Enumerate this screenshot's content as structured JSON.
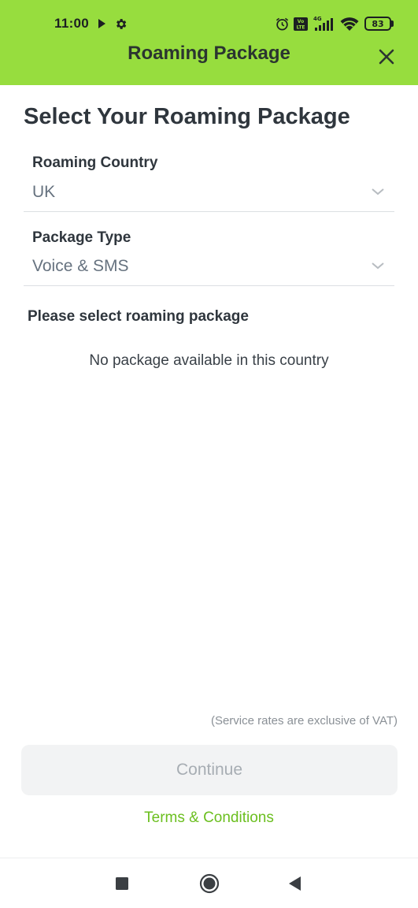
{
  "status_bar": {
    "time": "11:00",
    "battery": "83",
    "network": "4G",
    "icons": [
      "play-icon",
      "gear-icon",
      "alarm-icon",
      "volte-icon",
      "signal-icon",
      "wifi-icon",
      "battery-icon"
    ]
  },
  "app_bar": {
    "title": "Roaming Package",
    "close_icon": "close-icon"
  },
  "main": {
    "title": "Select Your Roaming Package",
    "country_field": {
      "label": "Roaming Country",
      "value": "UK"
    },
    "package_type_field": {
      "label": "Package Type",
      "value": "Voice & SMS"
    },
    "package_section_label": "Please select roaming package",
    "empty_message": "No package available in this country",
    "vat_note": "(Service rates are exclusive of VAT)",
    "continue_label": "Continue",
    "terms_label": "Terms & Conditions"
  },
  "nav_bar": {
    "icons": [
      "recents-icon",
      "home-icon",
      "back-icon"
    ]
  },
  "colors": {
    "header_bg": "#97dd3e",
    "accent_link": "#6bbf1f",
    "disabled_button_bg": "#f2f3f4"
  }
}
